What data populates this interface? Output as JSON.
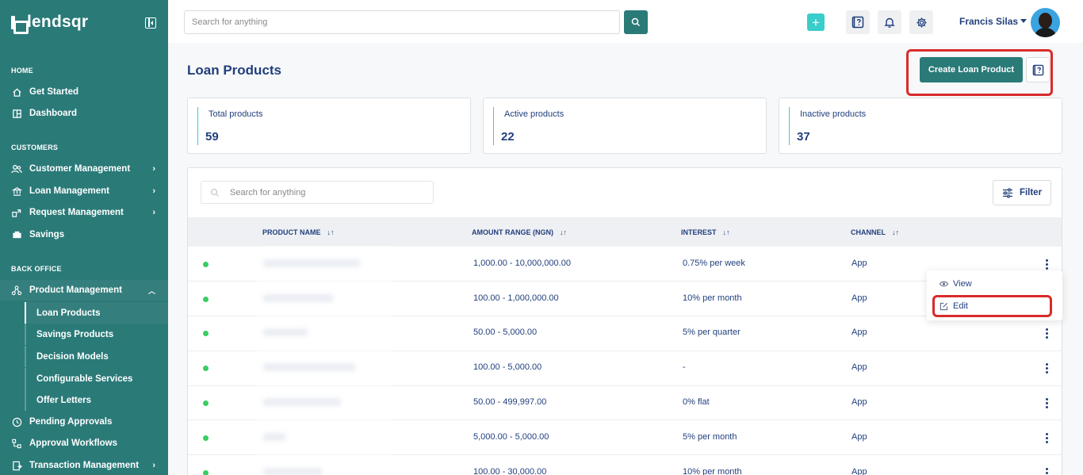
{
  "brand": {
    "name": "lendsqr"
  },
  "header": {
    "search_placeholder": "Search for anything",
    "user_name": "Francis Silas"
  },
  "sidebar": {
    "sections": [
      {
        "title": "HOME",
        "items": [
          {
            "label": "Get Started",
            "icon": "home-icon"
          },
          {
            "label": "Dashboard",
            "icon": "dashboard-icon"
          }
        ]
      },
      {
        "title": "CUSTOMERS",
        "items": [
          {
            "label": "Customer Management",
            "icon": "users-icon",
            "has_children": true
          },
          {
            "label": "Loan Management",
            "icon": "bank-icon",
            "has_children": true
          },
          {
            "label": "Request Management",
            "icon": "request-icon",
            "has_children": true
          },
          {
            "label": "Savings",
            "icon": "piggy-bank-icon"
          }
        ]
      },
      {
        "title": "BACK OFFICE",
        "items": [
          {
            "label": "Product Management",
            "icon": "product-icon",
            "expanded": true
          },
          {
            "label": "Pending Approvals",
            "icon": "pending-icon"
          },
          {
            "label": "Approval Workflows",
            "icon": "workflow-icon"
          },
          {
            "label": "Transaction Management",
            "icon": "transaction-icon",
            "has_children": true
          }
        ]
      }
    ],
    "product_sub_items": [
      {
        "label": "Loan Products",
        "active": true
      },
      {
        "label": "Savings Products"
      },
      {
        "label": "Decision Models"
      },
      {
        "label": "Configurable Services"
      },
      {
        "label": "Offer Letters"
      }
    ]
  },
  "page": {
    "title": "Loan Products",
    "create_button": "Create Loan Product"
  },
  "stats": [
    {
      "label": "Total products",
      "value": "59"
    },
    {
      "label": "Active products",
      "value": "22"
    },
    {
      "label": "Inactive products",
      "value": "37"
    }
  ],
  "table": {
    "search_placeholder": "Search for anything",
    "filter_label": "Filter",
    "columns": [
      "PRODUCT NAME",
      "AMOUNT RANGE (NGN)",
      "INTEREST",
      "CHANNEL"
    ],
    "rows": [
      {
        "status": "active",
        "amount": "1,000.00 - 10,000,000.00",
        "interest": "0.75% per week",
        "channel": "App"
      },
      {
        "status": "active",
        "amount": "100.00 - 1,000,000.00",
        "interest": "10% per month",
        "channel": "App"
      },
      {
        "status": "active",
        "amount": "50.00 - 5,000.00",
        "interest": "5% per quarter",
        "channel": "App"
      },
      {
        "status": "active",
        "amount": "100.00 - 5,000.00",
        "interest": "-",
        "channel": "App"
      },
      {
        "status": "active",
        "amount": "50.00 - 499,997.00",
        "interest": "0% flat",
        "channel": "App"
      },
      {
        "status": "active",
        "amount": "5,000.00 - 5,000.00",
        "interest": "5% per month",
        "channel": "App"
      },
      {
        "status": "active",
        "amount": "100.00 - 30,000.00",
        "interest": "10% per month",
        "channel": "App"
      }
    ],
    "row_menu": [
      {
        "label": "View",
        "icon": "eye-icon"
      },
      {
        "label": "Edit",
        "icon": "edit-icon"
      }
    ]
  },
  "colors": {
    "sidebar_bg": "#2a7a78",
    "accent": "#39cdcc",
    "primary_text": "#213f7d",
    "active_dot": "#39cd62",
    "highlight": "#d92a2a"
  }
}
